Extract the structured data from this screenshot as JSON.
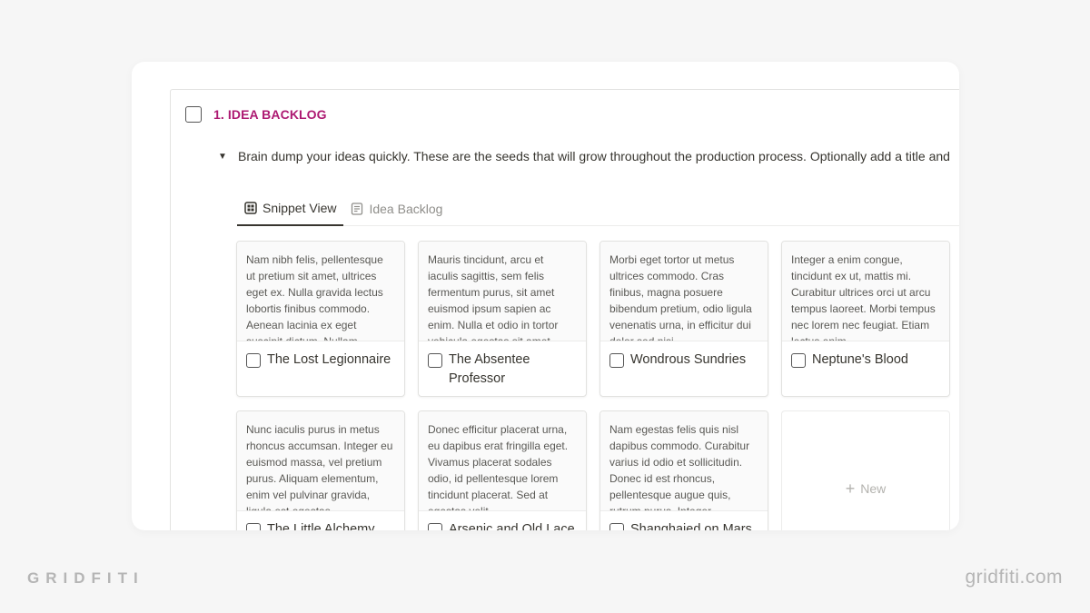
{
  "section": {
    "title": "1. IDEA BACKLOG",
    "description": "Brain dump your ideas quickly. These are the seeds that will grow throughout the production process. Optionally add a title and"
  },
  "tabs": [
    {
      "label": "Snippet View",
      "icon": "gallery-icon",
      "active": true
    },
    {
      "label": "Idea Backlog",
      "icon": "page-icon",
      "active": false
    }
  ],
  "cards": [
    {
      "title": "The Lost Legionnaire",
      "preview": "Nam nibh felis, pellentesque ut pretium sit amet, ultrices eget ex. Nulla gravida lectus lobortis finibus commodo. Aenean lacinia ex eget suscipit dictum. Nullam"
    },
    {
      "title": "The Absentee Professor",
      "preview": "Mauris tincidunt, arcu et iaculis sagittis, sem felis fermentum purus, sit amet euismod ipsum sapien ac enim. Nulla et odio in tortor vehicula egestas sit amet"
    },
    {
      "title": "Wondrous Sundries",
      "preview": "Morbi eget tortor ut metus ultrices commodo. Cras finibus, magna posuere bibendum pretium, odio ligula venenatis urna, in efficitur dui dolor sed nisi"
    },
    {
      "title": "Neptune's Blood",
      "preview": "Integer a enim congue, tincidunt ex ut, mattis mi. Curabitur ultrices orci ut arcu tempus laoreet. Morbi tempus nec lorem nec feugiat. Etiam lectus enim"
    },
    {
      "title": "The Little Alchemy",
      "preview": "Nunc iaculis purus in metus rhoncus accumsan. Integer eu euismod massa, vel pretium purus. Aliquam elementum, enim vel pulvinar gravida, ligula est egestas"
    },
    {
      "title": "Arsenic and Old Lace",
      "preview": "Donec efficitur placerat urna, eu dapibus erat fringilla eget. Vivamus placerat sodales odio, id pellentesque lorem tincidunt placerat. Sed at egestas velit"
    },
    {
      "title": "Shanghaied on Mars",
      "preview": "Nam egestas felis quis nisl dapibus commodo. Curabitur varius id odio et sollicitudin. Donec id est rhoncus, pellentesque augue quis, rutrum purus. Integer"
    }
  ],
  "new_button": {
    "label": "New",
    "icon": "plus-icon"
  },
  "branding": {
    "left": "GRIDFITI",
    "right": "gridfiti.com"
  },
  "colors": {
    "accent": "#ad1a72",
    "background": "#f6f6f6"
  }
}
